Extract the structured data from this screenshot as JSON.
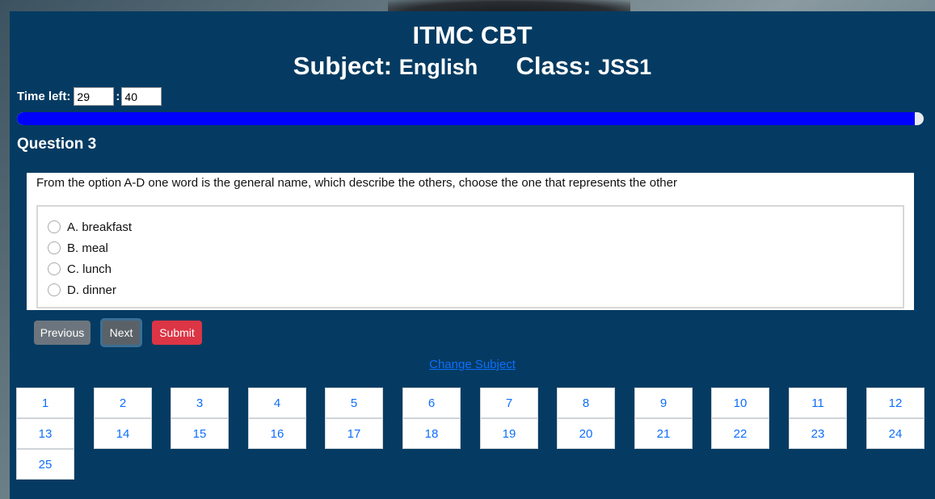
{
  "header": {
    "title": "ITMC CBT",
    "subject_label": "Subject:",
    "subject_value": "English",
    "class_label": "Class:",
    "class_value": "JSS1"
  },
  "timer": {
    "label": "Time left:",
    "minutes": "29",
    "separator": ":",
    "seconds": "40"
  },
  "progress": {
    "percent": 99
  },
  "question": {
    "heading": "Question 3",
    "text": "From the option A-D one word is the general name, which describe the others, choose the one that represents the other",
    "options": [
      {
        "label": "A. breakfast",
        "selected": false
      },
      {
        "label": "B. meal",
        "selected": false
      },
      {
        "label": "C. lunch",
        "selected": false
      },
      {
        "label": "D. dinner",
        "selected": false
      }
    ]
  },
  "buttons": {
    "previous": "Previous",
    "next": "Next",
    "submit": "Submit"
  },
  "change_subject": "Change Subject",
  "question_numbers": [
    "1",
    "2",
    "3",
    "4",
    "5",
    "6",
    "7",
    "8",
    "9",
    "10",
    "11",
    "12",
    "13",
    "14",
    "15",
    "16",
    "17",
    "18",
    "19",
    "20",
    "21",
    "22",
    "23",
    "24",
    "25"
  ],
  "colors": {
    "panel_bg": "#053b62",
    "progress": "#0000ff",
    "submit": "#dc3545",
    "link": "#0d6efd"
  }
}
